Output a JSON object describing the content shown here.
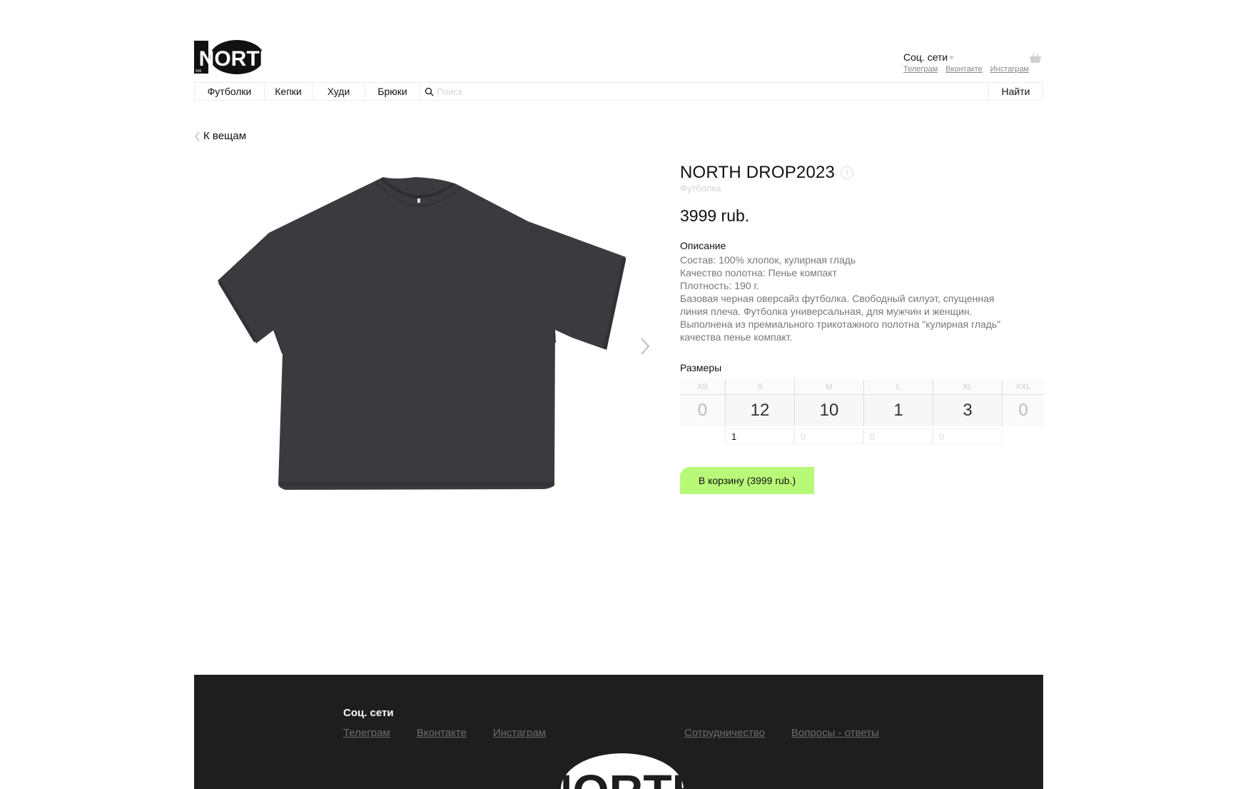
{
  "header": {
    "logo_text": "NORTH",
    "social_title": "Соц. сети",
    "social_links": [
      "Телеграм",
      "Вконтакте",
      "Инстаграм"
    ]
  },
  "nav": {
    "items": [
      "Футболки",
      "Кепки",
      "Худи",
      "Брюки"
    ],
    "search_placeholder": "Поиск",
    "find_label": "Найти"
  },
  "back_label": "К вещам",
  "product": {
    "title": "NORTH DROP2023",
    "category": "Футболка",
    "price": "3999 rub.",
    "description_title": "Описание",
    "description_lines": [
      "Состав: 100% хлопок, кулирная гладь",
      "Качество полотна: Пенье компакт",
      "Плотность: 190 г.",
      "Базовая черная оверсайз футболка. Свободный силуэт, спущенная",
      "линия плеча. Футболка универсальная, для мужчин и женщин.",
      "Выполнена из премиального трикотажного полотна \"кулирная гладь\"",
      "качества пенье компакт."
    ],
    "sizes_title": "Размеры",
    "sizes": [
      {
        "label": "XS",
        "stock": "0"
      },
      {
        "label": "S",
        "stock": "12"
      },
      {
        "label": "M",
        "stock": "10"
      },
      {
        "label": "L",
        "stock": "1"
      },
      {
        "label": "XL",
        "stock": "3"
      },
      {
        "label": "XXL",
        "stock": "0"
      }
    ],
    "quantities": [
      {
        "value": "1",
        "placeholder": ""
      },
      {
        "value": "",
        "placeholder": "0"
      },
      {
        "value": "",
        "placeholder": "0"
      },
      {
        "value": "",
        "placeholder": "0"
      }
    ],
    "add_to_cart": "В корзину (3999 rub.)",
    "image_color": "#3b3b3f"
  },
  "footer": {
    "social_title": "Соц. сети",
    "social_links": [
      "Телеграм",
      "Вконтакте",
      "Инстаграм"
    ],
    "other_links": [
      "Сотрудничество",
      "Вопросы - ответы"
    ],
    "logo_text": "NORTH"
  },
  "colors": {
    "accent": "#b9f978",
    "footer_bg": "#1e1e1e"
  }
}
